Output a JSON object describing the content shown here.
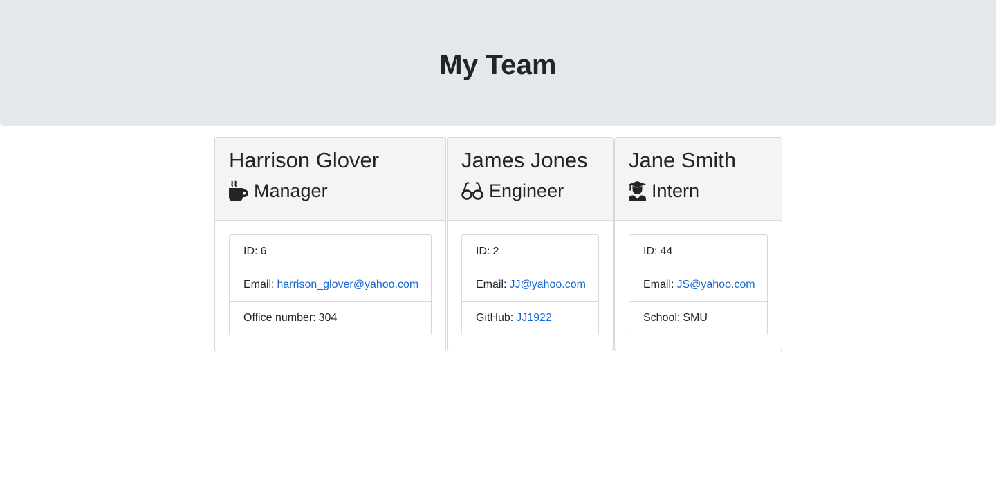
{
  "header": {
    "title": "My Team"
  },
  "employees": [
    {
      "name": "Harrison Glover",
      "role": "Manager",
      "icon": "mug-icon",
      "id_label": "ID:",
      "id_value": "6",
      "email_label": "Email:",
      "email": "harrison_glover@yahoo.com",
      "extra_label": "Office number:",
      "extra_value": "304"
    },
    {
      "name": "James Jones",
      "role": "Engineer",
      "icon": "glasses-icon",
      "id_label": "ID:",
      "id_value": "2",
      "email_label": "Email:",
      "email": "JJ@yahoo.com",
      "extra_label": "GitHub:",
      "extra_value": "JJ1922"
    },
    {
      "name": "Jane Smith",
      "role": "Intern",
      "icon": "graduate-icon",
      "id_label": "ID:",
      "id_value": "44",
      "email_label": "Email:",
      "email": "JS@yahoo.com",
      "extra_label": "School:",
      "extra_value": "SMU"
    }
  ],
  "colors": {
    "header_bg": "#e4e7eb",
    "card_header_bg": "#f4f4f4",
    "link": "#1a66d2",
    "text": "#212529",
    "border": "#d6d8db"
  }
}
